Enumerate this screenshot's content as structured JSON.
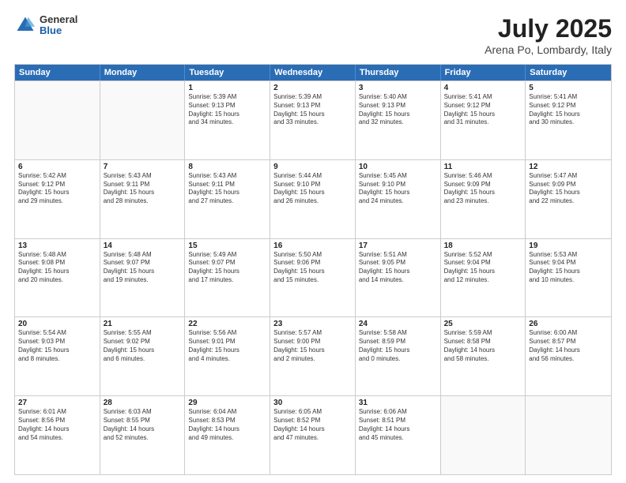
{
  "header": {
    "logo": {
      "general": "General",
      "blue": "Blue"
    },
    "title": "July 2025",
    "subtitle": "Arena Po, Lombardy, Italy"
  },
  "days": [
    "Sunday",
    "Monday",
    "Tuesday",
    "Wednesday",
    "Thursday",
    "Friday",
    "Saturday"
  ],
  "weeks": [
    [
      {
        "day": "",
        "info": ""
      },
      {
        "day": "",
        "info": ""
      },
      {
        "day": "1",
        "info": "Sunrise: 5:39 AM\nSunset: 9:13 PM\nDaylight: 15 hours\nand 34 minutes."
      },
      {
        "day": "2",
        "info": "Sunrise: 5:39 AM\nSunset: 9:13 PM\nDaylight: 15 hours\nand 33 minutes."
      },
      {
        "day": "3",
        "info": "Sunrise: 5:40 AM\nSunset: 9:13 PM\nDaylight: 15 hours\nand 32 minutes."
      },
      {
        "day": "4",
        "info": "Sunrise: 5:41 AM\nSunset: 9:12 PM\nDaylight: 15 hours\nand 31 minutes."
      },
      {
        "day": "5",
        "info": "Sunrise: 5:41 AM\nSunset: 9:12 PM\nDaylight: 15 hours\nand 30 minutes."
      }
    ],
    [
      {
        "day": "6",
        "info": "Sunrise: 5:42 AM\nSunset: 9:12 PM\nDaylight: 15 hours\nand 29 minutes."
      },
      {
        "day": "7",
        "info": "Sunrise: 5:43 AM\nSunset: 9:11 PM\nDaylight: 15 hours\nand 28 minutes."
      },
      {
        "day": "8",
        "info": "Sunrise: 5:43 AM\nSunset: 9:11 PM\nDaylight: 15 hours\nand 27 minutes."
      },
      {
        "day": "9",
        "info": "Sunrise: 5:44 AM\nSunset: 9:10 PM\nDaylight: 15 hours\nand 26 minutes."
      },
      {
        "day": "10",
        "info": "Sunrise: 5:45 AM\nSunset: 9:10 PM\nDaylight: 15 hours\nand 24 minutes."
      },
      {
        "day": "11",
        "info": "Sunrise: 5:46 AM\nSunset: 9:09 PM\nDaylight: 15 hours\nand 23 minutes."
      },
      {
        "day": "12",
        "info": "Sunrise: 5:47 AM\nSunset: 9:09 PM\nDaylight: 15 hours\nand 22 minutes."
      }
    ],
    [
      {
        "day": "13",
        "info": "Sunrise: 5:48 AM\nSunset: 9:08 PM\nDaylight: 15 hours\nand 20 minutes."
      },
      {
        "day": "14",
        "info": "Sunrise: 5:48 AM\nSunset: 9:07 PM\nDaylight: 15 hours\nand 19 minutes."
      },
      {
        "day": "15",
        "info": "Sunrise: 5:49 AM\nSunset: 9:07 PM\nDaylight: 15 hours\nand 17 minutes."
      },
      {
        "day": "16",
        "info": "Sunrise: 5:50 AM\nSunset: 9:06 PM\nDaylight: 15 hours\nand 15 minutes."
      },
      {
        "day": "17",
        "info": "Sunrise: 5:51 AM\nSunset: 9:05 PM\nDaylight: 15 hours\nand 14 minutes."
      },
      {
        "day": "18",
        "info": "Sunrise: 5:52 AM\nSunset: 9:04 PM\nDaylight: 15 hours\nand 12 minutes."
      },
      {
        "day": "19",
        "info": "Sunrise: 5:53 AM\nSunset: 9:04 PM\nDaylight: 15 hours\nand 10 minutes."
      }
    ],
    [
      {
        "day": "20",
        "info": "Sunrise: 5:54 AM\nSunset: 9:03 PM\nDaylight: 15 hours\nand 8 minutes."
      },
      {
        "day": "21",
        "info": "Sunrise: 5:55 AM\nSunset: 9:02 PM\nDaylight: 15 hours\nand 6 minutes."
      },
      {
        "day": "22",
        "info": "Sunrise: 5:56 AM\nSunset: 9:01 PM\nDaylight: 15 hours\nand 4 minutes."
      },
      {
        "day": "23",
        "info": "Sunrise: 5:57 AM\nSunset: 9:00 PM\nDaylight: 15 hours\nand 2 minutes."
      },
      {
        "day": "24",
        "info": "Sunrise: 5:58 AM\nSunset: 8:59 PM\nDaylight: 15 hours\nand 0 minutes."
      },
      {
        "day": "25",
        "info": "Sunrise: 5:59 AM\nSunset: 8:58 PM\nDaylight: 14 hours\nand 58 minutes."
      },
      {
        "day": "26",
        "info": "Sunrise: 6:00 AM\nSunset: 8:57 PM\nDaylight: 14 hours\nand 56 minutes."
      }
    ],
    [
      {
        "day": "27",
        "info": "Sunrise: 6:01 AM\nSunset: 8:56 PM\nDaylight: 14 hours\nand 54 minutes."
      },
      {
        "day": "28",
        "info": "Sunrise: 6:03 AM\nSunset: 8:55 PM\nDaylight: 14 hours\nand 52 minutes."
      },
      {
        "day": "29",
        "info": "Sunrise: 6:04 AM\nSunset: 8:53 PM\nDaylight: 14 hours\nand 49 minutes."
      },
      {
        "day": "30",
        "info": "Sunrise: 6:05 AM\nSunset: 8:52 PM\nDaylight: 14 hours\nand 47 minutes."
      },
      {
        "day": "31",
        "info": "Sunrise: 6:06 AM\nSunset: 8:51 PM\nDaylight: 14 hours\nand 45 minutes."
      },
      {
        "day": "",
        "info": ""
      },
      {
        "day": "",
        "info": ""
      }
    ]
  ]
}
